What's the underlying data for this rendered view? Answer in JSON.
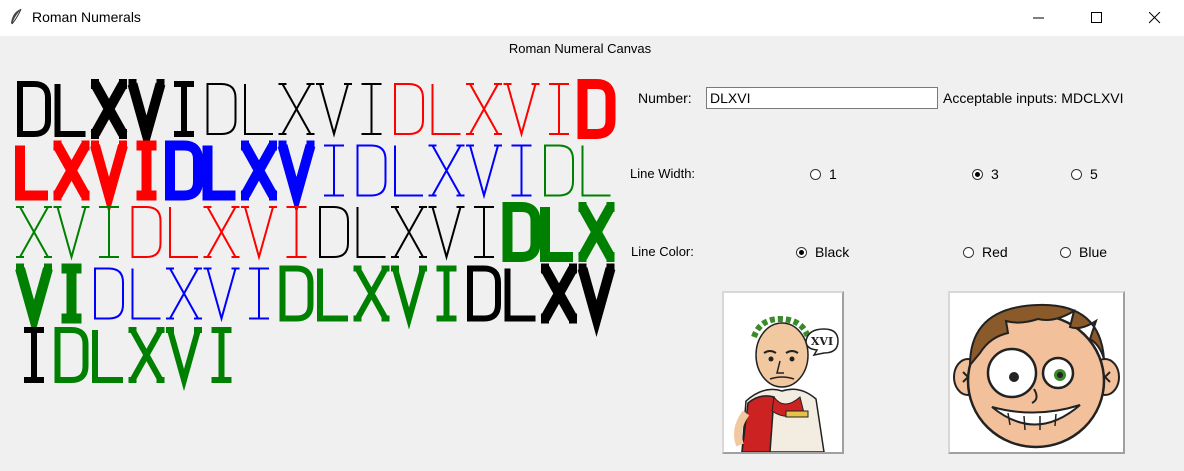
{
  "window": {
    "title": "Roman Numerals"
  },
  "canvas": {
    "title": "Roman Numeral Canvas",
    "rows": [
      [
        "D",
        "L",
        "X",
        "V",
        "I",
        "D",
        "L",
        "X",
        "V",
        "I",
        "D",
        "L",
        "X",
        "V",
        "I",
        "D"
      ],
      [
        "L",
        "X",
        "V",
        "I",
        "D",
        "L",
        "X",
        "V",
        "I",
        "D",
        "L",
        "X",
        "V",
        "I",
        "D",
        "L"
      ],
      [
        "X",
        "V",
        "I",
        "D",
        "L",
        "X",
        "V",
        "I",
        "D",
        "L",
        "X",
        "V",
        "I",
        "D",
        "L",
        "X"
      ],
      [
        "V",
        "I",
        "D",
        "L",
        "X",
        "V",
        "I",
        "D",
        "L",
        "X",
        "V",
        "I",
        "D",
        "L",
        "X",
        "V"
      ],
      [
        "I",
        "D",
        "L",
        "X",
        "V",
        "I"
      ]
    ],
    "colors": [
      [
        "#000000",
        "#000000",
        "#000000",
        "#000000",
        "#000000",
        "#000000",
        "#000000",
        "#000000",
        "#000000",
        "#000000",
        "#ff0000",
        "#ff0000",
        "#ff0000",
        "#ff0000",
        "#ff0000",
        "#ff0000"
      ],
      [
        "#ff0000",
        "#ff0000",
        "#ff0000",
        "#ff0000",
        "#0000ff",
        "#0000ff",
        "#0000ff",
        "#0000ff",
        "#0000ff",
        "#0000ff",
        "#0000ff",
        "#0000ff",
        "#0000ff",
        "#0000ff",
        "#008000",
        "#008000"
      ],
      [
        "#008000",
        "#008000",
        "#008000",
        "#ff0000",
        "#ff0000",
        "#ff0000",
        "#ff0000",
        "#ff0000",
        "#000000",
        "#000000",
        "#000000",
        "#000000",
        "#000000",
        "#008000",
        "#008000",
        "#008000"
      ],
      [
        "#008000",
        "#008000",
        "#0000ff",
        "#0000ff",
        "#0000ff",
        "#0000ff",
        "#0000ff",
        "#008000",
        "#008000",
        "#008000",
        "#008000",
        "#008000",
        "#000000",
        "#000000",
        "#000000",
        "#000000"
      ],
      [
        "#000000",
        "#008000",
        "#008000",
        "#008000",
        "#008000",
        "#008000"
      ]
    ],
    "widths": [
      [
        3,
        3,
        5,
        5,
        3,
        1,
        1,
        1,
        1,
        1,
        1,
        1,
        1,
        1,
        1,
        5
      ],
      [
        5,
        5,
        5,
        5,
        5,
        5,
        5,
        5,
        1,
        1,
        1,
        1,
        1,
        1,
        1,
        1
      ],
      [
        1,
        1,
        1,
        1,
        1,
        1,
        1,
        1,
        1,
        1,
        1,
        1,
        1,
        5,
        5,
        5
      ],
      [
        5,
        5,
        1,
        1,
        1,
        1,
        1,
        3,
        3,
        3,
        3,
        3,
        3,
        3,
        5,
        5
      ],
      [
        3,
        3,
        3,
        3,
        3,
        3
      ]
    ]
  },
  "controls": {
    "number_label": "Number:",
    "number_value": "DLXVI",
    "acceptable_label": "Acceptable inputs: MDCLXVI",
    "line_width_label": "Line Width:",
    "line_width_options": [
      "1",
      "3",
      "5"
    ],
    "line_width_selected": "3",
    "line_color_label": "Line Color:",
    "line_color_options": [
      "Black",
      "Red",
      "Blue"
    ],
    "line_color_selected": "Black",
    "caesar_bubble": "XVI"
  }
}
